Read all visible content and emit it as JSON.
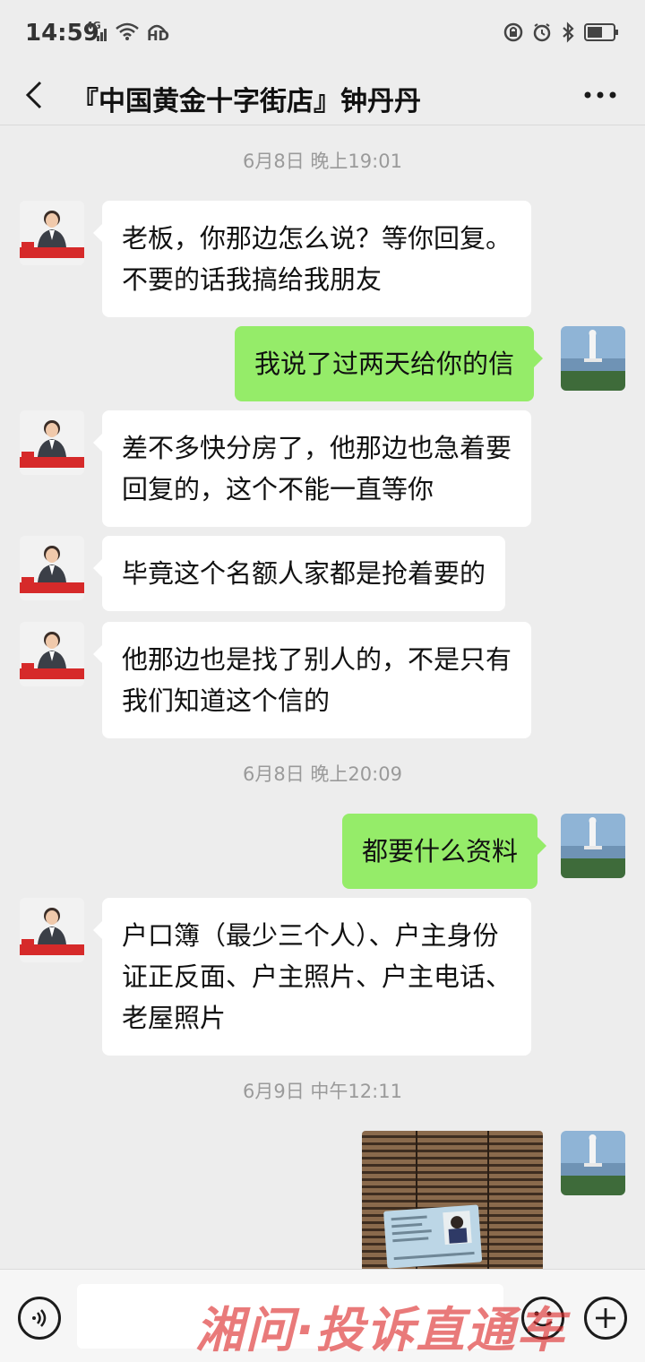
{
  "status_bar": {
    "time": "14:59",
    "network": "4G",
    "hd": "HD",
    "icons": [
      "signal-icon",
      "wifi-icon",
      "hd-call-icon",
      "lock-rotation-icon",
      "alarm-icon",
      "bluetooth-icon",
      "battery-icon"
    ]
  },
  "header": {
    "title": "『中国黄金十字街店』钟丹丹",
    "back_icon": "chevron-left-icon",
    "more_icon": "more-dots-icon"
  },
  "messages": [
    {
      "type": "timestamp",
      "text": "6月8日 晚上19:01"
    },
    {
      "type": "incoming",
      "lines": [
        "老板，你那边怎么说？等你回复。",
        "不要的话我搞给我朋友"
      ]
    },
    {
      "type": "outgoing",
      "lines": [
        "我说了过两天给你的信"
      ]
    },
    {
      "type": "incoming",
      "lines": [
        "差不多快分房了，他那边也急着要",
        "回复的，这个不能一直等你"
      ]
    },
    {
      "type": "incoming",
      "lines": [
        "毕竟这个名额人家都是抢着要的"
      ]
    },
    {
      "type": "incoming",
      "lines": [
        "他那边也是找了别人的，不是只有",
        "我们知道这个信的"
      ]
    },
    {
      "type": "timestamp",
      "text": "6月8日 晚上20:09"
    },
    {
      "type": "outgoing",
      "lines": [
        "都要什么资料"
      ]
    },
    {
      "type": "incoming",
      "lines": [
        "户口簿（最少三个人）、户主身份",
        "证正反面、户主照片、户主电话、",
        "老屋照片"
      ]
    },
    {
      "type": "timestamp",
      "text": "6月9日 中午12:11"
    },
    {
      "type": "outgoing-image",
      "description": "id-card-photo"
    }
  ],
  "input_bar": {
    "voice_icon": "voice-icon",
    "emoji_icon": "emoji-icon",
    "plus_icon": "plus-icon",
    "value": ""
  },
  "watermark": "湘问·投诉直通车",
  "colors": {
    "background": "#ededed",
    "outgoing_bubble": "#95ec69",
    "incoming_bubble": "#ffffff",
    "watermark": "#dc2828"
  }
}
